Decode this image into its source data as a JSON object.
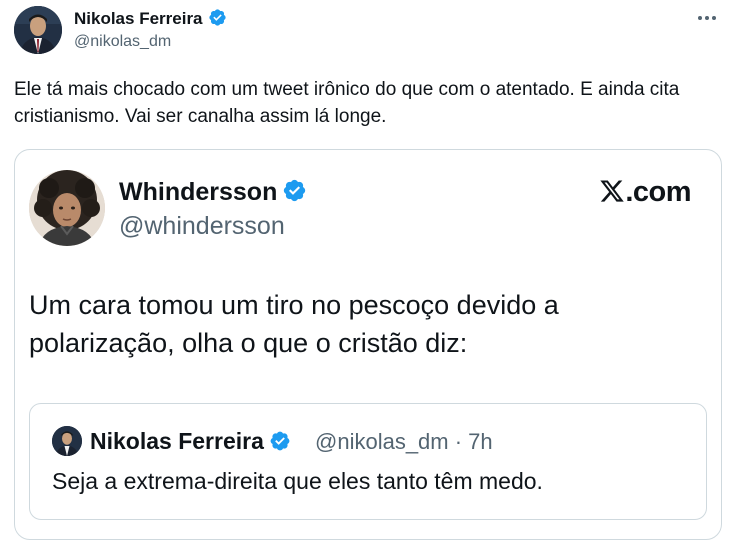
{
  "post": {
    "author": {
      "name": "Nikolas Ferreira",
      "handle": "@nikolas_dm",
      "verified": true
    },
    "text": "Ele tá mais chocado com um tweet irônico do que com o atentado. E ainda cita cristianismo. Vai ser canalha assim lá longe."
  },
  "embed": {
    "author": {
      "name": "Whindersson",
      "handle": "@whindersson",
      "verified": true
    },
    "brand": ".com",
    "text": "Um cara tomou um tiro no pescoço devido a polarização, olha o que o cristão diz:",
    "quote": {
      "author": {
        "name": "Nikolas Ferreira",
        "handle_time": "@nikolas_dm · 7h",
        "verified": true
      },
      "text": "Seja a extrema-direita que eles tanto têm medo."
    }
  },
  "colors": {
    "verified_blue": "#1d9bf0",
    "secondary_text": "#536471",
    "border": "#cfd9de"
  },
  "icons": [
    "more-icon",
    "verified-icon",
    "x-logo-icon"
  ]
}
